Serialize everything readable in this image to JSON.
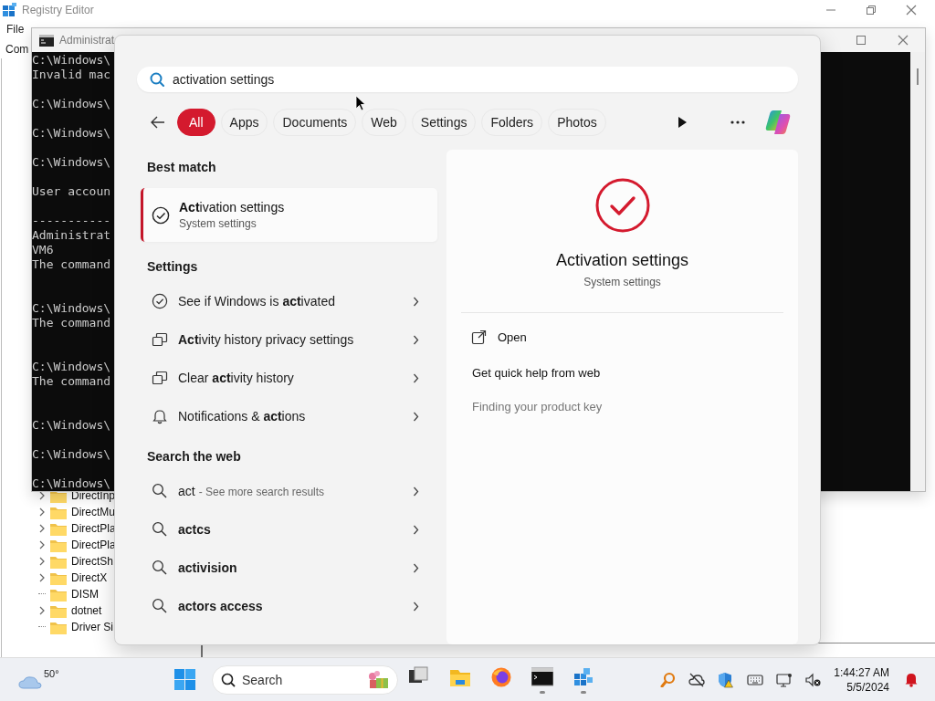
{
  "registry_editor": {
    "title": "Registry Editor",
    "menu": [
      "File"
    ],
    "address": "Com",
    "tree": [
      {
        "name": "DirectInp",
        "has_children": true
      },
      {
        "name": "DirectMu",
        "has_children": true
      },
      {
        "name": "DirectPla",
        "has_children": true
      },
      {
        "name": "DirectPla",
        "has_children": true
      },
      {
        "name": "DirectSh",
        "has_children": true
      },
      {
        "name": "DirectX",
        "has_children": true
      },
      {
        "name": "DISM",
        "has_children": false
      },
      {
        "name": "dotnet",
        "has_children": true
      },
      {
        "name": "Driver Si",
        "has_children": false
      }
    ]
  },
  "command_prompt": {
    "title": "Administrat",
    "lines": [
      {
        "kind": "text",
        "text": "C:\\Windows\\"
      },
      {
        "kind": "text",
        "text": "Invalid mac"
      },
      {
        "kind": "blank"
      },
      {
        "kind": "text",
        "text": "C:\\Windows\\"
      },
      {
        "kind": "blank"
      },
      {
        "kind": "text",
        "text": "C:\\Windows\\"
      },
      {
        "kind": "blank"
      },
      {
        "kind": "text",
        "text": "C:\\Windows\\"
      },
      {
        "kind": "blank"
      },
      {
        "kind": "text",
        "text": "User accoun"
      },
      {
        "kind": "blank"
      },
      {
        "kind": "text",
        "text": "-----------"
      },
      {
        "kind": "text",
        "text": "Administrat"
      },
      {
        "kind": "text",
        "text": "VM6"
      },
      {
        "kind": "text",
        "text": "The command"
      },
      {
        "kind": "blank"
      },
      {
        "kind": "blank"
      },
      {
        "kind": "text",
        "text": "C:\\Windows\\"
      },
      {
        "kind": "text",
        "text": "The command"
      },
      {
        "kind": "blank"
      },
      {
        "kind": "blank"
      },
      {
        "kind": "text",
        "text": "C:\\Windows\\"
      },
      {
        "kind": "text",
        "text": "The command"
      },
      {
        "kind": "blank"
      },
      {
        "kind": "blank"
      },
      {
        "kind": "text",
        "text": "C:\\Windows\\"
      },
      {
        "kind": "blank"
      },
      {
        "kind": "text",
        "text": "C:\\Windows\\"
      },
      {
        "kind": "blank"
      },
      {
        "kind": "text",
        "text": "C:\\Windows\\"
      }
    ]
  },
  "search": {
    "query": "activation settings",
    "filters": [
      {
        "label": "All",
        "selected": true
      },
      {
        "label": "Apps",
        "selected": false
      },
      {
        "label": "Documents",
        "selected": false
      },
      {
        "label": "Web",
        "selected": false
      },
      {
        "label": "Settings",
        "selected": false
      },
      {
        "label": "Folders",
        "selected": false
      },
      {
        "label": "Photos",
        "selected": false
      }
    ],
    "best_match": {
      "heading": "Best match",
      "title": "**Act**ivation settings",
      "subtitle": "System settings",
      "selected": true
    },
    "settings": {
      "heading": "Settings",
      "items": [
        {
          "kind": "check",
          "label": "See if Windows is **act**ivated"
        },
        {
          "kind": "windows",
          "label": "**Act**ivity history privacy settings"
        },
        {
          "kind": "windows",
          "label": "Clear **act**ivity history"
        },
        {
          "kind": "bell",
          "label": "Notifications & **act**ions"
        }
      ]
    },
    "web": {
      "heading": "Search the web",
      "items": [
        {
          "label": "act",
          "hint": "- See more search results"
        },
        {
          "label": "actcs"
        },
        {
          "label": "activision"
        },
        {
          "label": "actors access"
        }
      ]
    },
    "preview": {
      "title": "Activation settings",
      "subtitle": "System settings",
      "actions": [
        {
          "kind": "open",
          "label": "Open"
        },
        {
          "kind": "heading",
          "label": "Get quick help from web"
        },
        {
          "kind": "link",
          "label": "Finding your product key"
        }
      ]
    }
  },
  "taskbar": {
    "temperature": "50°",
    "search_placeholder": "Search",
    "time": "1:44:27 AM",
    "date": "5/5/2024",
    "apps": [
      {
        "kind": "task-view",
        "running": false
      },
      {
        "kind": "explorer",
        "running": false
      },
      {
        "kind": "firefox",
        "running": false
      },
      {
        "kind": "terminal",
        "running": true
      },
      {
        "kind": "regedit",
        "running": true
      }
    ]
  }
}
